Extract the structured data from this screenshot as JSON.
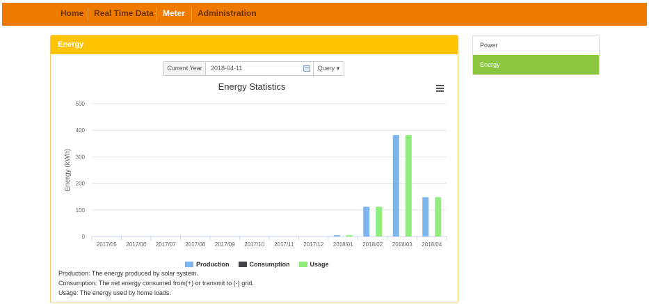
{
  "nav": {
    "items": [
      {
        "label": "Home",
        "active": false
      },
      {
        "label": "Real Time Data",
        "active": false
      },
      {
        "label": "Meter",
        "active": true
      },
      {
        "label": "Administration",
        "active": false
      }
    ],
    "accent": "#ef7a00"
  },
  "panel": {
    "title": "Energy",
    "accent": "#ffc400"
  },
  "query": {
    "label": "Current Year",
    "date_value": "2018-04-11",
    "button_label": "Query",
    "calendar_icon": "calendar-icon",
    "caret_icon": "caret-down-icon"
  },
  "sidebar": {
    "items": [
      {
        "label": "Power",
        "active": false
      },
      {
        "label": "Energy",
        "active": true
      }
    ],
    "active_color": "#8cc63f"
  },
  "chart_menu_icon": "hamburger-menu-icon",
  "chart_data": {
    "type": "bar",
    "title": "Energy Statistics",
    "xlabel": "",
    "ylabel": "Energy (kWh)",
    "ylim": [
      0,
      500
    ],
    "yticks": [
      0,
      100,
      200,
      300,
      400,
      500
    ],
    "grid": true,
    "legend_position": "bottom",
    "categories": [
      "2017/05",
      "2017/06",
      "2017/07",
      "2017/08",
      "2017/09",
      "2017/10",
      "2017/11",
      "2017/12",
      "2018/01",
      "2018/02",
      "2018/03",
      "2018/04"
    ],
    "series": [
      {
        "name": "Production",
        "color": "#7cb5ec",
        "values": [
          0,
          0,
          0,
          0,
          0,
          0,
          0,
          0,
          5,
          112,
          382,
          148
        ]
      },
      {
        "name": "Consumption",
        "color": "#434348",
        "values": [
          0,
          0,
          0,
          0,
          0,
          0,
          0,
          0,
          0,
          0,
          0,
          0
        ]
      },
      {
        "name": "Usage",
        "color": "#90ed7d",
        "values": [
          0,
          0,
          0,
          0,
          0,
          0,
          0,
          0,
          5,
          112,
          382,
          148
        ]
      }
    ]
  },
  "notes": [
    "Production: The energy produced by solar system.",
    "Consumption: The net energy consumed from(+) or transmit to (-) grid.",
    "Usage: The energy used by home loads."
  ]
}
